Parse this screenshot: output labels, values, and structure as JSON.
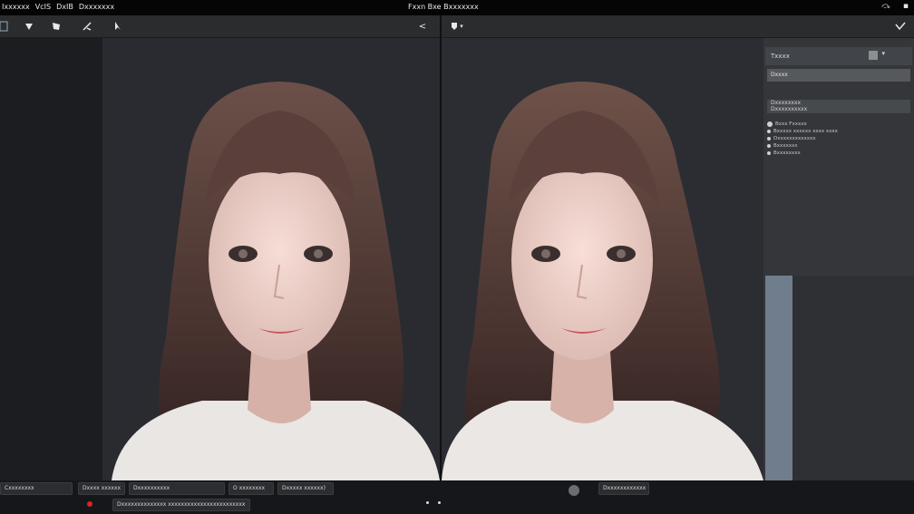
{
  "menubar": {
    "items": [
      "Ixxxxxx",
      "VcIS",
      "DxIB",
      "Dxxxxxxx"
    ],
    "title": "Fxxn Bxe Bxxxxxxx",
    "right_icons": [
      "minimize-icon",
      "maximize-icon"
    ]
  },
  "toolbar_left": {
    "tools": [
      "crop-icon",
      "transform-icon",
      "mask-icon",
      "brush-icon",
      "pointer-icon"
    ],
    "collapse_glyph": "<"
  },
  "toolbar_right": {
    "tools": [
      "shield-icon"
    ],
    "dropdown_glyph": "▾",
    "collapse_glyph": "⌵"
  },
  "panel": {
    "header": "Txxxx",
    "dropdown": "▾",
    "field_value": "Dxxxx",
    "section_title": "Dxxxxxxxx",
    "section_sub": "Dxxxxxxxxxx",
    "list": [
      {
        "label": "Bxxx Fxxxxx",
        "radio": true
      },
      {
        "label": "Bxxxxx xxxxxx xxxx xxxx"
      },
      {
        "label": "Dxxxxxxxxxxxxx"
      },
      {
        "label": "Bxxxxxxx"
      },
      {
        "label": "Bxxxxxxxx"
      }
    ]
  },
  "status": {
    "row1": [
      "Cxxxxxxxx",
      "Dxxxx xxxxxx",
      "Dxxxxxxxxxx",
      "O xxxxxxxx",
      "Dxxxxx xxxxxx)",
      "Dxxxxxxxxxxxx"
    ],
    "row2_left": "Dxxxxxxxxxxxxxx xxxxxxxxxxxxxxxxxxxxxxxx"
  },
  "colors": {
    "accent": "#6f7d8c",
    "record": "#dd2222"
  }
}
